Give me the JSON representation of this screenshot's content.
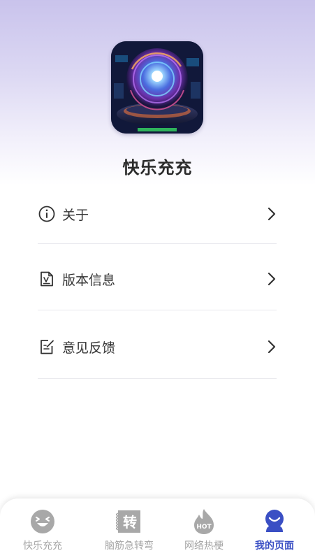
{
  "app": {
    "name": "快乐充充"
  },
  "menu": {
    "items": [
      {
        "label": "关于",
        "icon": "info-icon"
      },
      {
        "label": "版本信息",
        "icon": "version-document-icon"
      },
      {
        "label": "意见反馈",
        "icon": "feedback-edit-icon"
      }
    ]
  },
  "tabbar": {
    "tabs": [
      {
        "label": "快乐充充",
        "icon": "smile-face-icon",
        "active": false
      },
      {
        "label": "脑筋急转弯",
        "icon": "zhuan-badge-icon",
        "icon_text": "转",
        "active": false
      },
      {
        "label": "网络热梗",
        "icon": "hot-flame-icon",
        "icon_text": "HOT",
        "active": false
      },
      {
        "label": "我的页面",
        "icon": "user-profile-icon",
        "active": true
      }
    ]
  },
  "colors": {
    "accent": "#3a4fc4",
    "inactive_tab": "#a5a5a5",
    "header_gradient_top": "#c9c3ec"
  }
}
